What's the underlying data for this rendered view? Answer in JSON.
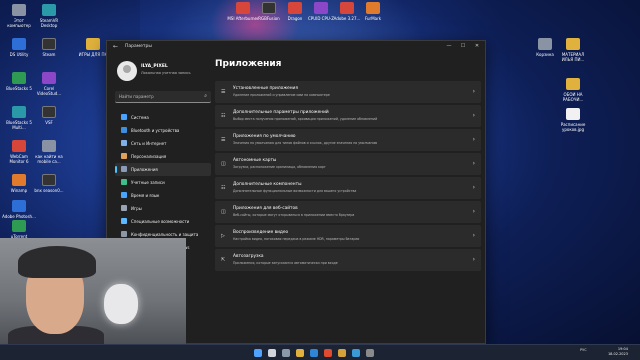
{
  "desktop": {
    "icons_left": [
      {
        "label": "Этот компьютер",
        "icon": "computer-icon"
      },
      {
        "label": "SteamVR Desktop",
        "icon": "steam-icon"
      },
      {
        "label": "DS Utility",
        "icon": "utility-icon"
      },
      {
        "label": "Steam",
        "icon": "steam-icon"
      },
      {
        "label": "ИГРЫ ДЛЯ ПК",
        "icon": "folder-icon"
      },
      {
        "label": "BlueStacks 5",
        "icon": "bluestacks-icon"
      },
      {
        "label": "Corel VideoStud...",
        "icon": "corel-icon"
      },
      {
        "label": "BlueStacks 5 Multi...",
        "icon": "bluestacks-icon"
      },
      {
        "label": "VSF",
        "icon": "app-icon"
      },
      {
        "label": "WebCam Monitor 6",
        "icon": "webcam-icon"
      },
      {
        "label": "Winamp",
        "icon": "winamp-icon"
      },
      {
        "label": "как найти на mobile ca...",
        "icon": "video-file-icon"
      },
      {
        "label": "Adobe Photosh...",
        "icon": "photoshop-icon"
      },
      {
        "label": "bnx season0...",
        "icon": "file-icon"
      },
      {
        "label": "uTorrent",
        "icon": "utorrent-icon"
      }
    ],
    "icons_top": [
      {
        "label": "MSI Afterburner",
        "icon": "afterburner-icon"
      },
      {
        "label": "RGBFusion",
        "icon": "rgb-icon"
      },
      {
        "label": "Dragon",
        "icon": "dragon-icon"
      },
      {
        "label": "CPUID CPU-Z",
        "icon": "cpuz-icon"
      },
      {
        "label": "Adobe 3.27...",
        "icon": "adobe-icon"
      },
      {
        "label": "FurMark",
        "icon": "furmark-icon"
      }
    ],
    "icons_right": [
      {
        "label": "Корзина",
        "icon": "recycle-bin-icon"
      },
      {
        "label": "МАТЕРИАЛ ИЛЬЯ ПИ...",
        "icon": "folder-icon"
      },
      {
        "label": "ОБОИ НА РАБОЧИ...",
        "icon": "folder-icon"
      },
      {
        "label": "Расписание уроков.jpg",
        "icon": "image-file-icon"
      }
    ]
  },
  "window": {
    "title": "Параметры",
    "controls": {
      "minimize": "—",
      "maximize": "☐",
      "close": "✕"
    }
  },
  "sidebar": {
    "user_name": "ILYA_PIXEL",
    "user_sub": "Локальная учетная запись",
    "search_placeholder": "Найти параметр",
    "items": [
      {
        "label": "Система",
        "color": "#4aa3ff"
      },
      {
        "label": "Bluetooth и устройства",
        "color": "#3f8fe0"
      },
      {
        "label": "Сеть и Интернет",
        "color": "#7fb0e8"
      },
      {
        "label": "Персонализация",
        "color": "#e0a15a"
      },
      {
        "label": "Приложения",
        "color": "#8a9bb8"
      },
      {
        "label": "Учетные записи",
        "color": "#3fc08a"
      },
      {
        "label": "Время и язык",
        "color": "#4aa3ff"
      },
      {
        "label": "Игры",
        "color": "#9aa3b3"
      },
      {
        "label": "Специальные возможности",
        "color": "#5cb8ff"
      },
      {
        "label": "Конфиденциальность и защита",
        "color": "#8d96a6"
      },
      {
        "label": "Центр обновления Windows",
        "color": "#4aa3ff"
      }
    ],
    "active_index": 4
  },
  "main": {
    "title": "Приложения",
    "cards": [
      {
        "title": "Установленные приложения",
        "sub": "Удаление приложений и управление ими на компьютере"
      },
      {
        "title": "Дополнительные параметры приложений",
        "sub": "Выбор места получения приложений, архивация приложений, удаление обновлений"
      },
      {
        "title": "Приложения по умолчанию",
        "sub": "Значения по умолчанию для типов файлов и ссылок, другие значения по умолчанию"
      },
      {
        "title": "Автономные карты",
        "sub": "Загрузки, расположение хранилища, обновления карт"
      },
      {
        "title": "Дополнительные компоненты",
        "sub": "Дополнительные функциональные возможности для вашего устройства"
      },
      {
        "title": "Приложения для веб-сайтов",
        "sub": "Веб-сайты, которые могут открываться в приложении вместо браузера"
      },
      {
        "title": "Воспроизведение видео",
        "sub": "Настройка видео, потоковая передача в режиме HDR, параметры батареи"
      },
      {
        "title": "Автозагрузка",
        "sub": "Приложения, которые запускаются автоматически при входе"
      }
    ]
  },
  "taskbar": {
    "tray_lang": "РУС",
    "time": "19:04",
    "date": "18.02.2023"
  }
}
